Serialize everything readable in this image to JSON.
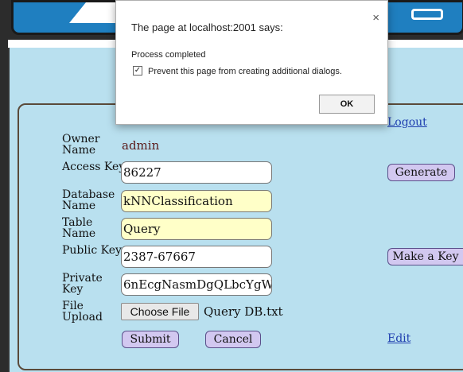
{
  "dialog": {
    "title": "The page at localhost:2001 says:",
    "close_glyph": "×",
    "message": "Process completed",
    "checkbox_label": "Prevent this page from creating additional dialogs.",
    "checkbox_checked": true,
    "check_glyph": "✓",
    "ok_label": "OK"
  },
  "form": {
    "logout_label": "Logout",
    "owner_name": {
      "label": "Owner Name",
      "value": "admin"
    },
    "access_key": {
      "label": "Access Key",
      "value": "86227"
    },
    "database_name": {
      "label": "Database Name",
      "value": "kNNClassification"
    },
    "table_name": {
      "label": "Table Name",
      "value": "Query"
    },
    "public_key": {
      "label": "Public Key",
      "value": "2387-67667"
    },
    "private_key": {
      "label": "Private Key",
      "value": "6nEcgNasmDgQLbcYgW"
    },
    "file_upload": {
      "label": "File Upload",
      "button_label": "Choose File",
      "file_name": "Query DB.txt"
    },
    "generate_label": "Generate",
    "make_key_label": "Make a Key",
    "submit_label": "Submit",
    "cancel_label": "Cancel",
    "edit_label": "Edit"
  },
  "colors": {
    "panel_bg": "#b9e0ef",
    "header_blue": "#1f7fc0",
    "button_purple": "#d2c8f0",
    "highlight_yellow": "#ffffc8",
    "link_blue": "#2040b0"
  }
}
